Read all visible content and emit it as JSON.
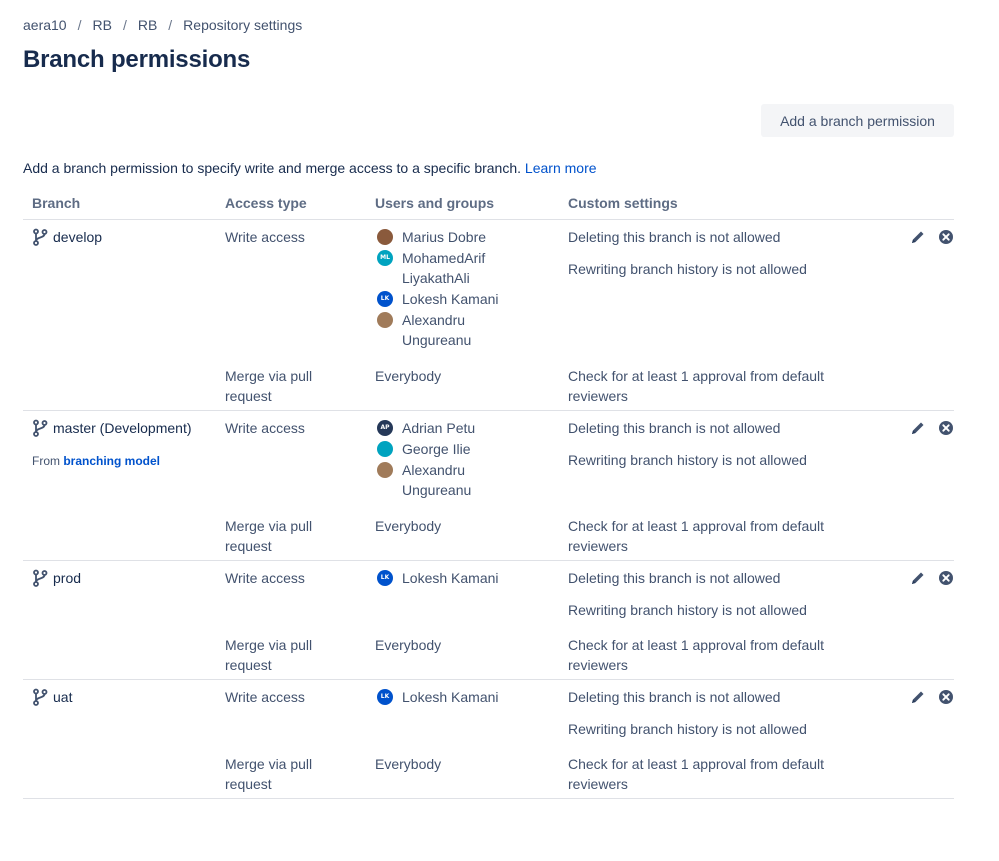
{
  "breadcrumb": [
    "aera10",
    "RB",
    "RB",
    "Repository settings"
  ],
  "breadcrumb_separator": "/",
  "title": "Branch permissions",
  "add_button_label": "Add a branch permission",
  "intro_text": "Add a branch permission to specify write and merge access to a specific branch.",
  "intro_link": "Learn more",
  "columns": [
    "Branch",
    "Access type",
    "Users and groups",
    "Custom settings"
  ],
  "colors": {
    "link": "#0052cc",
    "text": "#42526e",
    "heading": "#172b4d",
    "border": "#dfe1e6"
  },
  "permissions": [
    {
      "branch": "develop",
      "write": {
        "access": "Write access",
        "users": [
          {
            "name": "Marius Dobre",
            "avatar_color": "#8a5a3c",
            "initials": ""
          },
          {
            "name": "MohamedArif LiyakathAli",
            "avatar_color": "#00a3bf",
            "initials": "ML"
          },
          {
            "name": "Lokesh Kamani",
            "avatar_color": "#0052cc",
            "initials": "LK"
          },
          {
            "name": "Alexandru Ungureanu",
            "avatar_color": "#a07b5a",
            "initials": ""
          }
        ],
        "settings": [
          "Deleting this branch is not allowed",
          "Rewriting branch history is not allowed"
        ]
      },
      "merge": {
        "access": "Merge via pull request",
        "users": "Everybody",
        "settings": "Check for at least 1 approval from default reviewers"
      }
    },
    {
      "branch": "master (Development)",
      "from_prefix": "From",
      "from_link": "branching model",
      "write": {
        "access": "Write access",
        "users": [
          {
            "name": "Adrian Petu",
            "avatar_color": "#253858",
            "initials": "AP"
          },
          {
            "name": "George Ilie",
            "avatar_color": "#00a3bf",
            "initials": ""
          },
          {
            "name": "Alexandru Ungureanu",
            "avatar_color": "#a07b5a",
            "initials": ""
          }
        ],
        "settings": [
          "Deleting this branch is not allowed",
          "Rewriting branch history is not allowed"
        ]
      },
      "merge": {
        "access": "Merge via pull request",
        "users": "Everybody",
        "settings": "Check for at least 1 approval from default reviewers"
      }
    },
    {
      "branch": "prod",
      "write": {
        "access": "Write access",
        "users": [
          {
            "name": "Lokesh Kamani",
            "avatar_color": "#0052cc",
            "initials": "LK"
          }
        ],
        "settings": [
          "Deleting this branch is not allowed",
          "Rewriting branch history is not allowed"
        ]
      },
      "merge": {
        "access": "Merge via pull request",
        "users": "Everybody",
        "settings": "Check for at least 1 approval from default reviewers"
      }
    },
    {
      "branch": "uat",
      "write": {
        "access": "Write access",
        "users": [
          {
            "name": "Lokesh Kamani",
            "avatar_color": "#0052cc",
            "initials": "LK"
          }
        ],
        "settings": [
          "Deleting this branch is not allowed",
          "Rewriting branch history is not allowed"
        ]
      },
      "merge": {
        "access": "Merge via pull request",
        "users": "Everybody",
        "settings": "Check for at least 1 approval from default reviewers"
      }
    }
  ]
}
